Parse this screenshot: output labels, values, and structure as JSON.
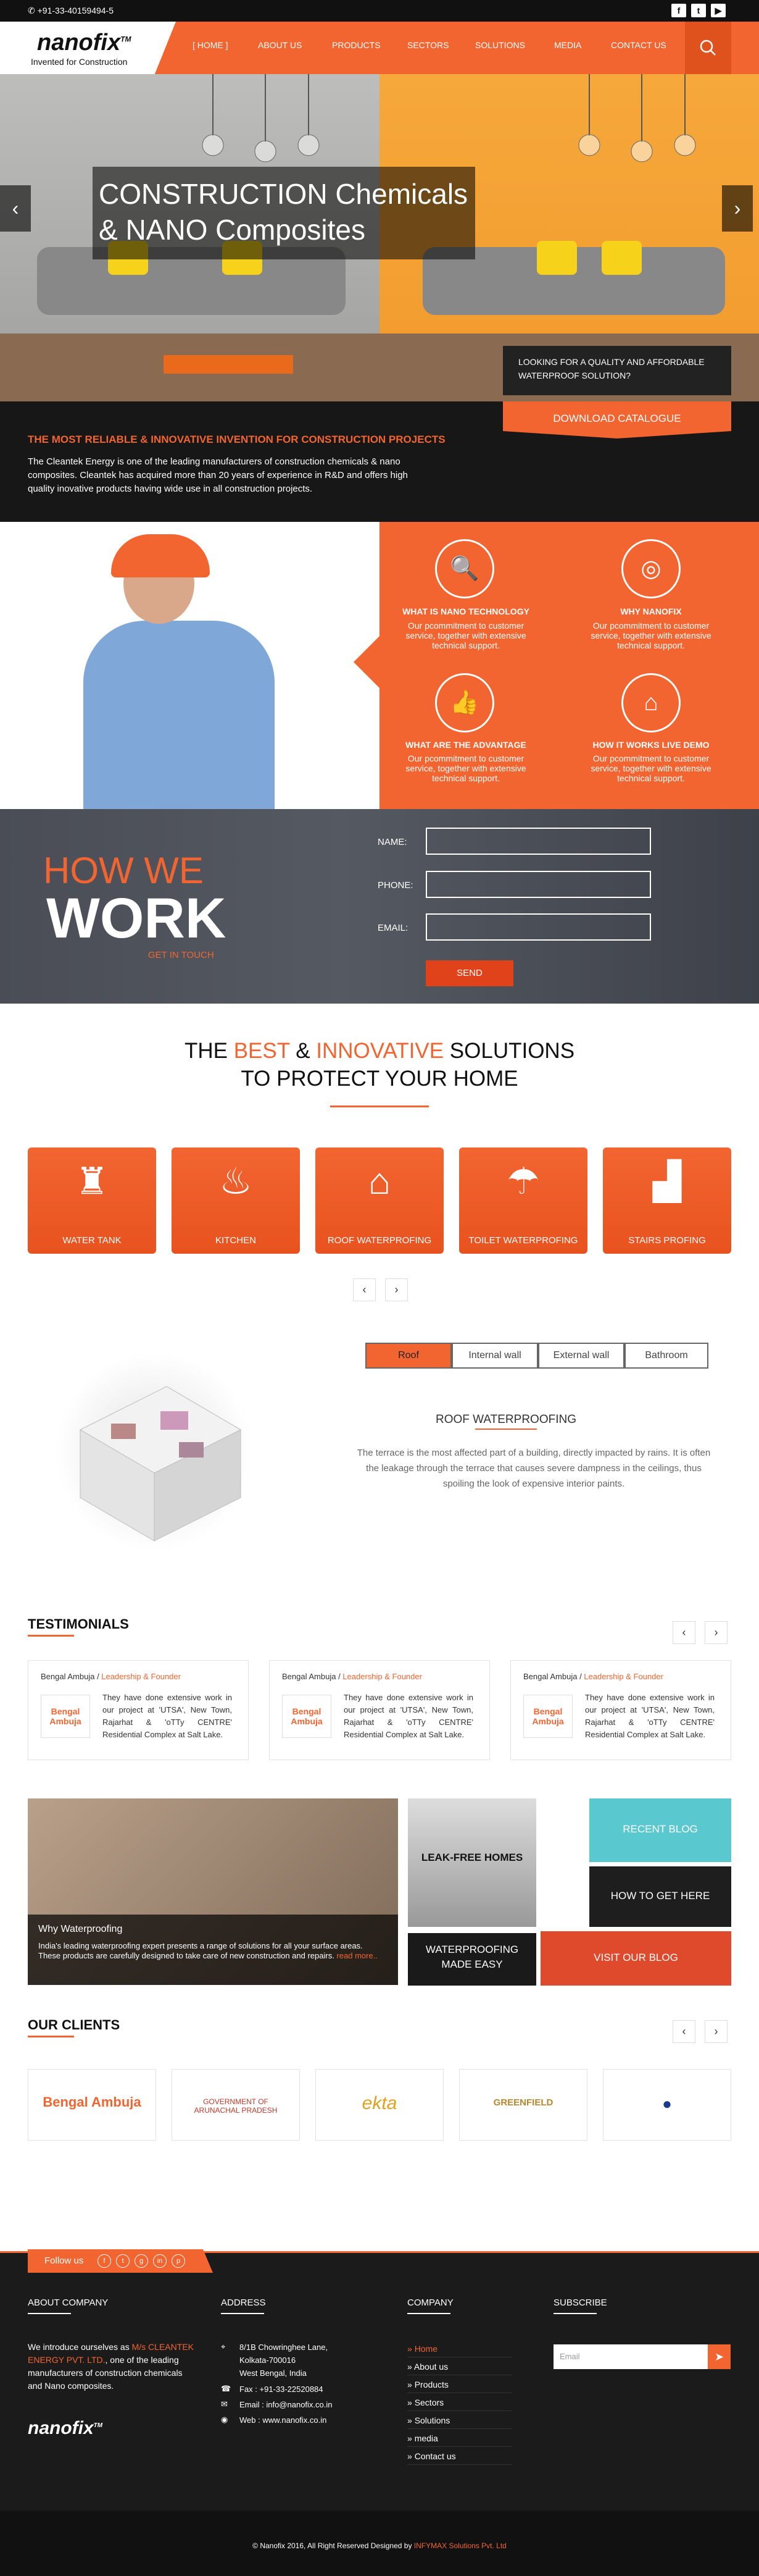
{
  "topbar": {
    "phone": "+91-33-40159494-5",
    "social": [
      "f",
      "t",
      "▶"
    ]
  },
  "logo": {
    "name": "nanofix",
    "tm": "TM",
    "tagline": "Invented for Construction"
  },
  "nav": {
    "items": [
      "[ HOME ]",
      "ABOUT US",
      "PRODUCTS",
      "SECTORS",
      "SOLUTIONS",
      "MEDIA",
      "CONTACT US"
    ]
  },
  "hero": {
    "title_line1": "CONSTRUCTION Chemicals",
    "title_line2": "& NANO Composites",
    "cta_text": "LOOKING FOR A QUALITY AND AFFORDABLE WATERPROOF SOLUTION?",
    "download_label": "DOWNLOAD CATALOGUE"
  },
  "intro": {
    "title": "THE MOST RELIABLE & INNOVATIVE INVENTION FOR CONSTRUCTION PROJECTS",
    "text": "The Cleantek Energy is one of the leading manufacturers of construction chemicals & nano composites. Cleantek has acquired more than 20 years of experience in R&D and offers high quality inovative products having wide use in all construction projects."
  },
  "features": [
    {
      "title": "WHAT IS NANO TECHNOLOGY",
      "desc": "Our pcommitment to customer service, together with extensive technical support."
    },
    {
      "title": "WHY NANOFIX",
      "desc": "Our pcommitment to customer service, together with extensive technical support."
    },
    {
      "title": "WHAT ARE THE ADVANTAGE",
      "desc": "Our pcommitment to customer service, together with extensive technical support."
    },
    {
      "title": "HOW IT WORKS LIVE DEMO",
      "desc": "Our pcommitment to customer service, together with extensive technical support."
    }
  ],
  "how_we_work": {
    "how": "HOW WE",
    "work": "WORK",
    "get_in_touch": "GET IN TOUCH",
    "name_label": "NAME:",
    "phone_label": "PHONE:",
    "email_label": "EMAIL:",
    "send": "SEND"
  },
  "solutions": {
    "t_the": "THE ",
    "t_best": "BEST",
    "t_amp": " & ",
    "t_innov": "INNOVATIVE",
    "t_sol": " SOLUTIONS",
    "line2": "TO PROTECT YOUR HOME",
    "tiles": [
      "WATER TANK",
      "KITCHEN",
      "ROOF WATERPROFING",
      "TOILET WATERPROFING",
      "STAIRS PROFING"
    ],
    "prev": "‹",
    "next": "›"
  },
  "house": {
    "tabs": [
      "Roof",
      "Internal wall",
      "External wall",
      "Bathroom"
    ],
    "title": "ROOF WATERPROOFING",
    "text": "The terrace is the most affected part of a building, directly impacted by rains. It is often the leakage through the terrace that causes severe dampness in the ceilings, thus spoiling the look of expensive interior paints."
  },
  "testimonials": {
    "title": "TESTIMONIALS",
    "prev": "‹",
    "next": "›",
    "cards": [
      {
        "name": "Bengal Ambuja / ",
        "role": "Leadership & Founder",
        "logo": "Bengal Ambuja",
        "text": "They have done extensive work in our project at 'UTSA', New Town, Rajarhat & 'oTTy CENTRE' Residential Complex at Salt Lake."
      },
      {
        "name": "Bengal Ambuja / ",
        "role": "Leadership & Founder",
        "logo": "Bengal Ambuja",
        "text": "They have done extensive work in our project at 'UTSA', New Town, Rajarhat & 'oTTy CENTRE' Residential Complex at Salt Lake."
      },
      {
        "name": "Bengal Ambuja / ",
        "role": "Leadership & Founder",
        "logo": "Bengal Ambuja",
        "text": "They have done extensive work in our project at 'UTSA', New Town, Rajarhat & 'oTTy CENTRE' Residential Complex at Salt Lake."
      }
    ]
  },
  "blog": {
    "why_title": "Why Waterproofing",
    "why_text": "India's leading waterproofing expert presents a range of solutions for all your surface areas. These products are carefully designed to take care of new construction and repairs.",
    "read_more": "read more..",
    "leak": "LEAK-FREE HOMES",
    "made_easy_1": "WATERPROOFING",
    "made_easy_2": "MADE EASY",
    "recent": "RECENT BLOG",
    "how_get": "HOW TO GET HERE",
    "visit": "VISIT OUR BLOG"
  },
  "clients": {
    "title": "OUR CLIENTS",
    "prev": "‹",
    "next": "›",
    "items": [
      "Bengal Ambuja",
      "GOVERNMENT OF ARUNACHAL PRADESH",
      "ekta",
      "GREENFIELD",
      "●"
    ]
  },
  "follow": {
    "label": "Follow us",
    "icons": [
      "f",
      "t",
      "g",
      "in",
      "p"
    ]
  },
  "footer": {
    "about_h": "ABOUT COMPANY",
    "about_1": "We introduce ourselves as ",
    "about_co": "M/s CLEANTEK ENERGY PVT. LTD.",
    "about_2": ", one of the leading manufacturers of construction chemicals and Nano composites.",
    "address_h": "ADDRESS",
    "addr1": "8/1B Chowringhee Lane,",
    "addr2": "Kolkata-700016",
    "addr3": "West Bengal, India",
    "fax": "Fax    : +91-33-22520884",
    "email": "Email : info@nanofix.co.in",
    "web": "Web  : www.nanofix.co.in",
    "company_h": "COMPANY",
    "links": [
      "Home",
      "About us",
      "Products",
      "Sectors",
      "Solutions",
      "media",
      "Contact us"
    ],
    "subscribe_h": "SUBSCRIBE",
    "email_placeholder": "Email",
    "copyright": "© Nanofix 2016, All Right Reserved Designed by ",
    "designer": "INFYMAX Solutions Pvt. Ltd"
  },
  "colors": {
    "accent": "#f26531",
    "dark": "#171717",
    "teal": "#5ac8cf"
  }
}
